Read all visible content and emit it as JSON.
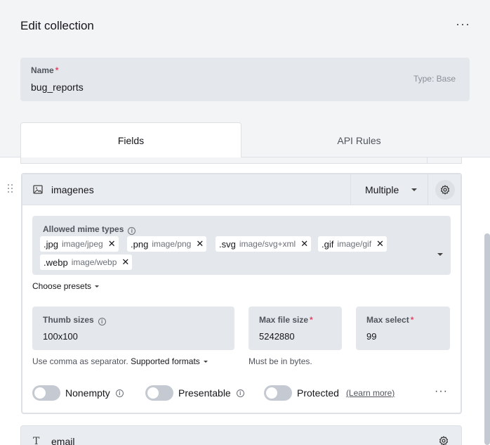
{
  "header": {
    "title": "Edit collection",
    "menu_icon": "more-horizontal-icon"
  },
  "name_field": {
    "label": "Name",
    "required_mark": "*",
    "value": "bug_reports",
    "type_badge": "Type: Base"
  },
  "tabs": [
    {
      "label": "Fields",
      "active": true
    },
    {
      "label": "API Rules",
      "active": false
    }
  ],
  "field": {
    "icon": "image-icon",
    "name": "imagenes",
    "mode": "Multiple",
    "settings_icon": "gear-icon",
    "mime": {
      "label": "Allowed mime types",
      "tags": [
        {
          "ext": ".jpg",
          "mime": "image/jpeg"
        },
        {
          "ext": ".png",
          "mime": "image/png"
        },
        {
          "ext": ".svg",
          "mime": "image/svg+xml"
        },
        {
          "ext": ".gif",
          "mime": "image/gif"
        },
        {
          "ext": ".webp",
          "mime": "image/webp"
        }
      ],
      "remove_glyph": "✕"
    },
    "choose_presets": "Choose presets",
    "thumb_sizes": {
      "label": "Thumb sizes",
      "value": "100x100"
    },
    "max_file_size": {
      "label": "Max file size",
      "required_mark": "*",
      "value": "5242880"
    },
    "max_select": {
      "label": "Max select",
      "required_mark": "*",
      "value": "99"
    },
    "thumb_help": "Use comma as separator.",
    "supported_formats": "Supported formats",
    "size_help": "Must be in bytes.",
    "toggles": {
      "nonempty": {
        "label": "Nonempty",
        "on": false
      },
      "presentable": {
        "label": "Presentable",
        "on": false
      },
      "protected": {
        "label": "Protected",
        "on": false,
        "link": "(Learn more)"
      }
    },
    "more_icon": "more-horizontal-icon"
  },
  "next_field": {
    "icon": "text-icon",
    "name": "email"
  },
  "colors": {
    "header_bg": "#f3f4f6",
    "field_bg": "#e4e8ec",
    "required": "#e34562"
  }
}
